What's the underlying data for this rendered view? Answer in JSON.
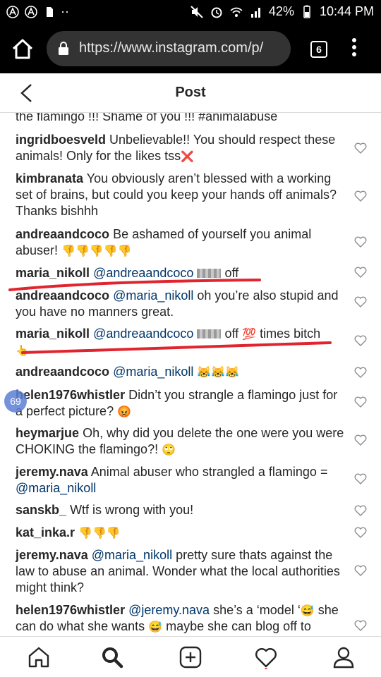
{
  "status_bar": {
    "battery": "42%",
    "time": "10:44 PM",
    "dots": "··"
  },
  "browser": {
    "url": "https://www.instagram.com/p/",
    "tab_count": "6"
  },
  "header": {
    "title": "Post"
  },
  "comments": [
    {
      "user": "",
      "text": "the flamingo !!! Shame of you !!! #animalabuse"
    },
    {
      "user": "ingridboesveld",
      "text": "Unbelievable!! You should respect these animals! Only for the likes tss",
      "emoji": "❌"
    },
    {
      "user": "kimbranata",
      "text": "You obviously aren’t blessed with a working set of brains, but could you keep your hands off animals? Thanks bishhh"
    },
    {
      "user": "andreaandcoco",
      "text": "Be ashamed of yourself you animal abuser!",
      "emoji": "👎👎👎👎👎"
    },
    {
      "user": "maria_nikoll",
      "mention": "@andreaandcoco",
      "text_after": "off"
    },
    {
      "user": "andreaandcoco",
      "mention": "@maria_nikoll",
      "text": "oh you’re also stupid and you have no manners great."
    },
    {
      "user": "maria_nikoll",
      "mention": "@andreaandcoco",
      "text_after": "off",
      "emoji": "💯",
      "text_end": "times bitch",
      "pointer": "👆"
    },
    {
      "user": "andreaandcoco",
      "mention": "@maria_nikoll",
      "emoji": "😹😹😹"
    },
    {
      "user": "helen1976whistler",
      "text": "Didn’t you strangle a flamingo just for a perfect picture?",
      "emoji": "😡"
    },
    {
      "user": "heymarjue",
      "text": "Oh, why did you delete the one were you were CHOKING the flamingo?!",
      "emoji": "🙄"
    },
    {
      "user": "jeremy.nava",
      "text": "Animal abuser who strangled a flamingo =",
      "mention": "@maria_nikoll"
    },
    {
      "user": "sanskb_",
      "text": "Wtf is wrong with you!"
    },
    {
      "user": "kat_inka.r",
      "emoji": "👎👎👎"
    },
    {
      "user": "jeremy.nava",
      "mention": "@maria_nikoll",
      "text": "pretty sure thats against the law to abuse an animal. Wonder what the local authorities might think?"
    },
    {
      "user": "helen1976whistler",
      "mention": "@jeremy.nava",
      "text": "she’s a ‘model ‘",
      "emoji": "😅",
      "text2": "she can do what she wants",
      "emoji2": "😅",
      "text3": "maybe she can blog off to"
    }
  ],
  "badge": {
    "count": "69"
  },
  "colors": {
    "mention": "#003569",
    "annotation_red": "#e0252f",
    "chrome_dark": "#000000"
  }
}
